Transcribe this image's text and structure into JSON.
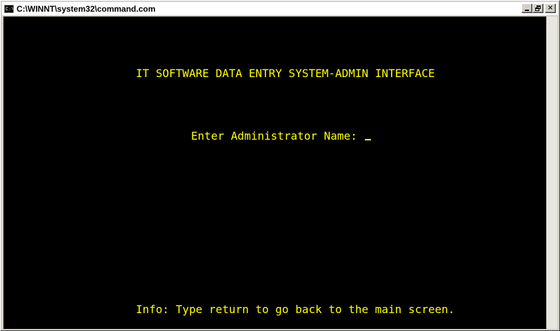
{
  "window": {
    "icon_text": "C:\\",
    "title": "C:\\WINNT\\system32\\command.com",
    "controls": {
      "minimize": "_",
      "maximize": "restore",
      "close": "×"
    }
  },
  "console": {
    "header": "IT SOFTWARE DATA ENTRY SYSTEM-ADMIN INTERFACE",
    "prompt_label": "Enter Administrator Name: ",
    "info": "Info: Type return to go back to the main screen.",
    "text_color": "#ffff00",
    "background_color": "#000000"
  }
}
